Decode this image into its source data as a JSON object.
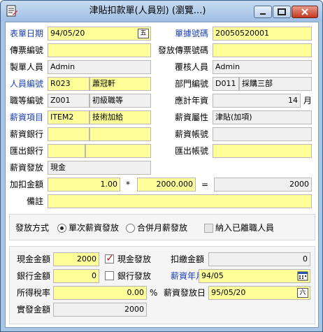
{
  "window": {
    "title": "津貼扣款單(人員別) (瀏覽...)"
  },
  "form": {
    "doc_date_label": "表單日期",
    "doc_date": "94/05/20",
    "doc_no_label": "單據號碼",
    "doc_no": "20050520001",
    "voucher_label": "傳票編號",
    "voucher": "",
    "issue_voucher_label": "發放傳票號碼",
    "issue_voucher": "",
    "creator_label": "製單人員",
    "creator": "Admin",
    "reviewer_label": "覆核人員",
    "reviewer": "Admin",
    "emp_no_label": "人員編號",
    "emp_no": "R023",
    "emp_name": "蕭冠軒",
    "dept_label": "部門編號",
    "dept_no": "D011",
    "dept_name": "採購三部",
    "grade_label": "職等編號",
    "grade_no": "Z001",
    "grade_name": "初級職等",
    "seniority_label": "應計年資",
    "seniority": "14",
    "seniority_unit": "月",
    "salary_item_label": "薪資項目",
    "salary_item_no": "ITEM2",
    "salary_item_name": "技術加給",
    "salary_attr_label": "薪資屬性",
    "salary_attr": "津貼(加項)",
    "salary_bank_label": "薪資銀行",
    "salary_account_label": "薪資帳號",
    "out_bank_label": "匯出銀行",
    "out_account_label": "匯出帳號",
    "pay_method_label": "薪資發放",
    "pay_method": "現金",
    "amount_label": "加扣金額",
    "amount": "1.00",
    "times_sign": "*",
    "multiplier": "2000.000",
    "equals_sign": "=",
    "total": "2000",
    "note_label": "備註",
    "note": ""
  },
  "issue": {
    "method_label": "發放方式",
    "option_single": "單次薪資發放",
    "option_merge": "合併月薪發放",
    "include_resigned": "納入已離職人員"
  },
  "payment": {
    "cash_label": "現金金額",
    "cash": "2000",
    "cash_check": "現金發放",
    "deduct_label": "扣繳金額",
    "deduct": "0",
    "bank_label": "銀行金額",
    "bank": "0",
    "bank_check": "銀行發放",
    "salary_month_label": "薪資年月",
    "salary_month": "94/05",
    "tax_rate_label": "所得稅率",
    "tax_rate": "0.00",
    "percent": "%",
    "pay_date_label": "薪資發放日",
    "pay_date": "95/05/20",
    "actual_label": "實發金額",
    "actual": "2000"
  },
  "icons": {
    "calendar": "calendar-icon",
    "app": "form-icon"
  },
  "colors": {
    "required_field": "#ffff99",
    "readonly_field": "#f0f0f0",
    "required_label": "#1a3fb0"
  }
}
